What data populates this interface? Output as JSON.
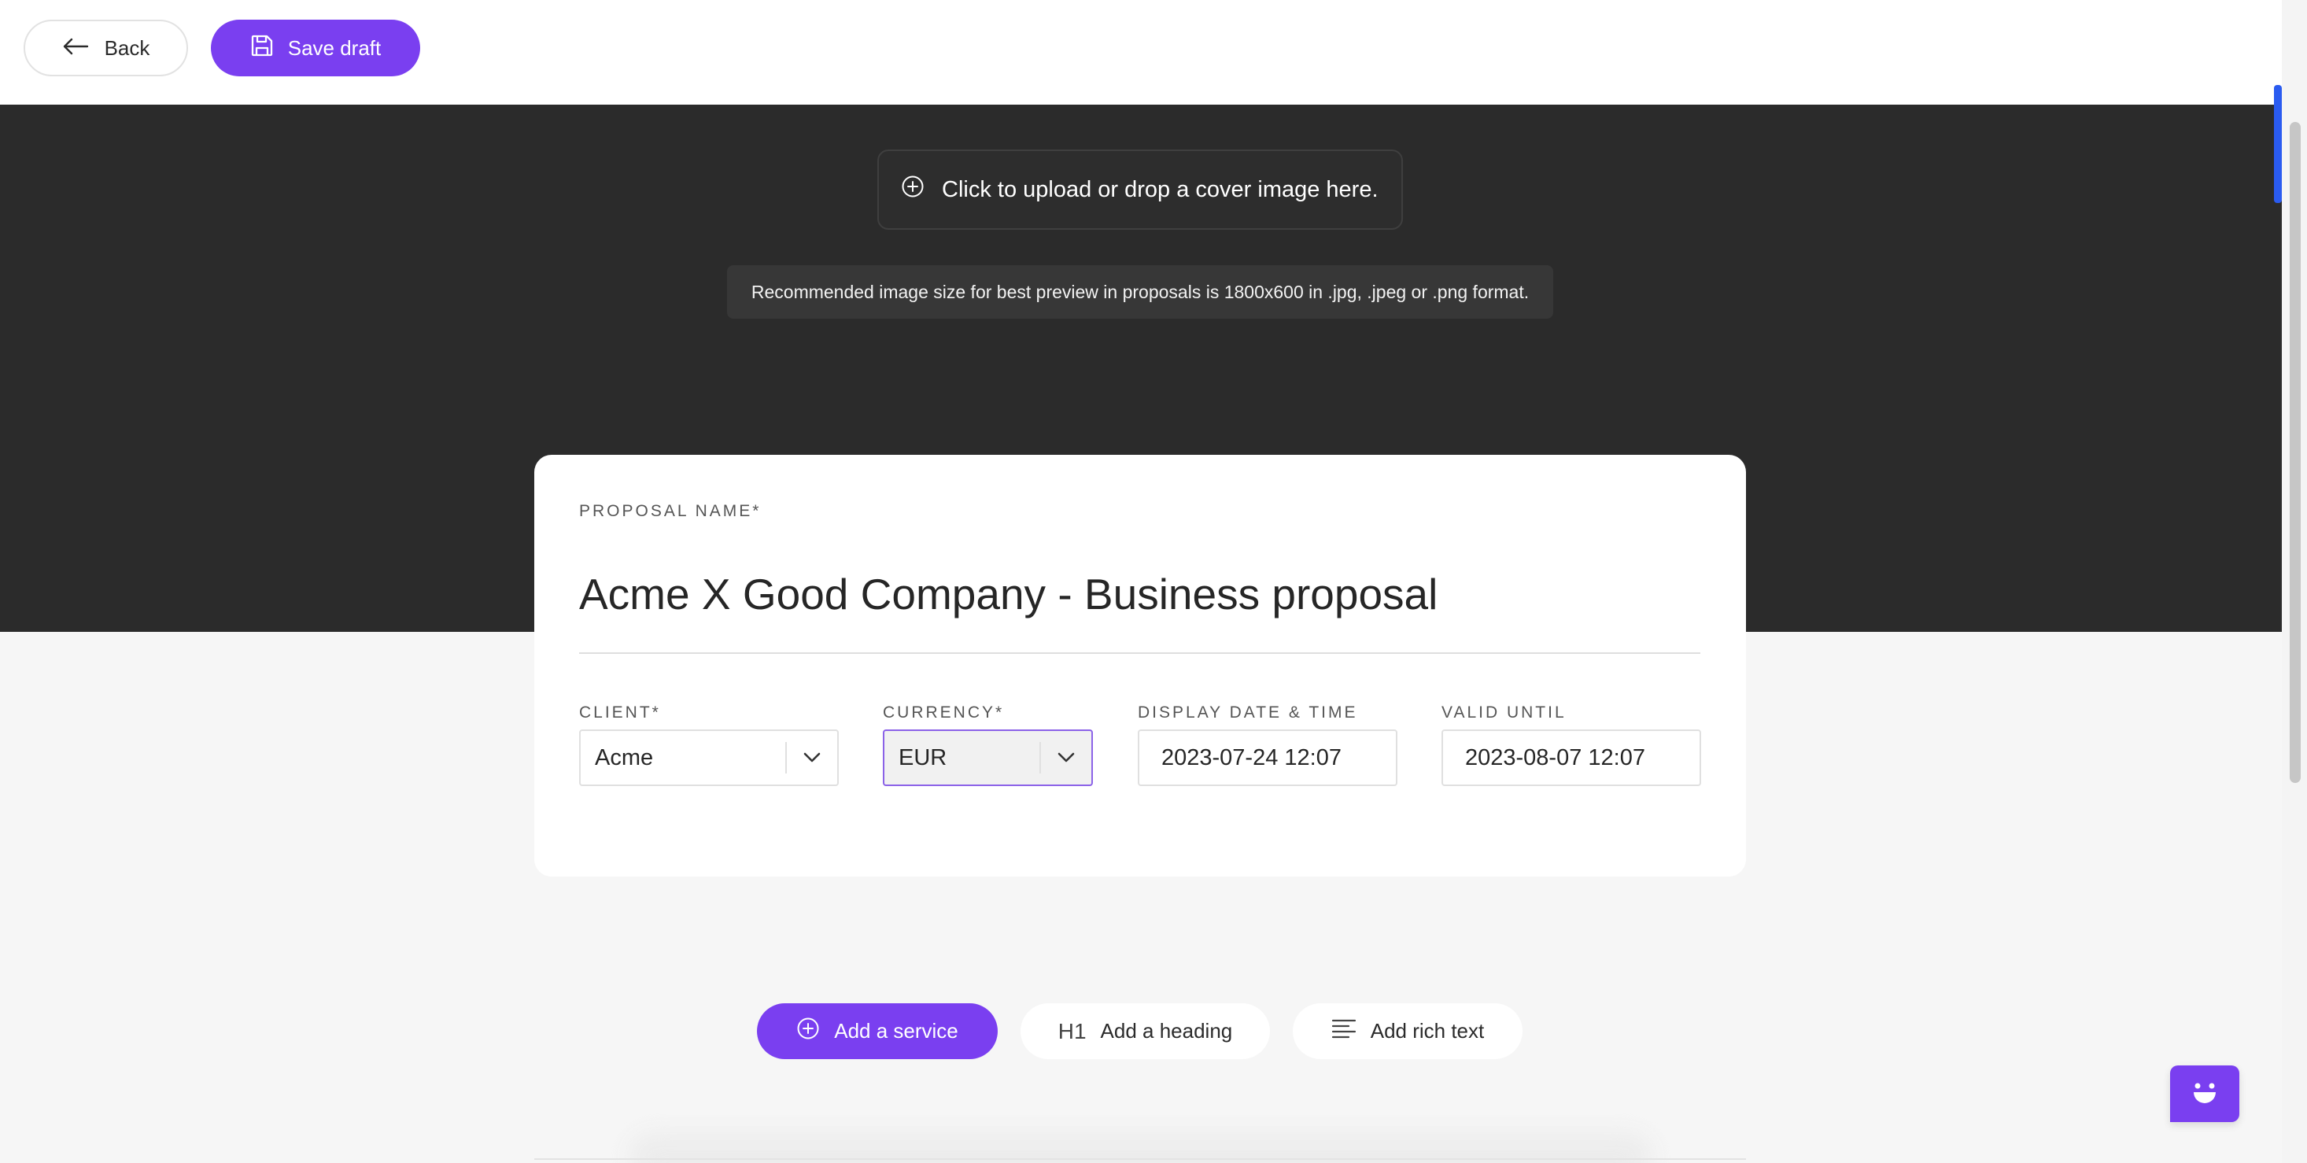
{
  "toolbar": {
    "back_label": "Back",
    "save_label": "Save draft"
  },
  "cover": {
    "upload_label": "Click to upload or drop a cover image here.",
    "hint": "Recommended image size for best preview in proposals is 1800x600 in .jpg, .jpeg or .png format."
  },
  "form": {
    "proposal_name_label": "PROPOSAL NAME*",
    "proposal_name_value": "Acme X Good Company - Business proposal",
    "client_label": "CLIENT*",
    "client_value": "Acme",
    "currency_label": "CURRENCY*",
    "currency_value": "EUR",
    "display_date_label": "DISPLAY DATE & TIME",
    "display_date_value": "2023-07-24 12:07",
    "valid_until_label": "VALID UNTIL",
    "valid_until_value": "2023-08-07 12:07"
  },
  "actions": {
    "add_service": "Add a service",
    "heading_mark": "H1",
    "add_heading": "Add a heading",
    "add_rich_text": "Add rich text"
  },
  "colors": {
    "accent": "#7a3ff0",
    "cover_bg": "#2b2b2b",
    "page_bg": "#f6f6f6",
    "scroll_accent": "#2a5bf0"
  },
  "icons": {
    "back": "arrow-left-icon",
    "save": "floppy-disk-icon",
    "upload": "plus-circle-icon",
    "dropdown": "chevron-down-icon",
    "service": "plus-circle-icon",
    "rich_text": "text-lines-icon",
    "chat": "chat-bot-icon"
  }
}
